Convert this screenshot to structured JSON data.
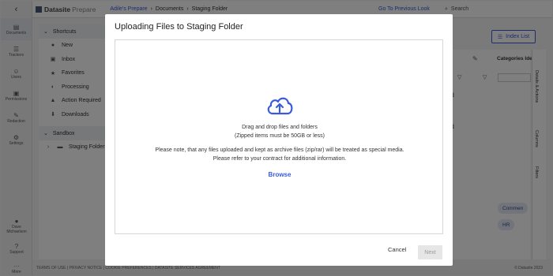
{
  "rail": {
    "items": [
      {
        "label": "Documents",
        "icon": "document-icon"
      },
      {
        "label": "Trackers",
        "icon": "list-icon"
      },
      {
        "label": "Users",
        "icon": "users-icon"
      },
      {
        "label": "Permissions",
        "icon": "lock-icon"
      },
      {
        "label": "Redaction",
        "icon": "pen-icon"
      },
      {
        "label": "Settings",
        "icon": "gear-icon"
      }
    ],
    "bottom": [
      {
        "label": "Dave\nMichaelson",
        "icon": "user-icon"
      },
      {
        "label": "Support",
        "icon": "help-icon"
      },
      {
        "label": "More",
        "icon": "more-icon"
      }
    ]
  },
  "topbar": {
    "brand": "Datasite",
    "product": "Prepare",
    "crumbs": [
      "Adile's Prepare",
      "Documents",
      "Staging Folder"
    ],
    "goto": "Go To Previous Look",
    "search": "Search"
  },
  "panel": {
    "shortcuts": "Shortcuts",
    "items": [
      "New",
      "Inbox",
      "Favorites",
      "Processing",
      "Action Required",
      "Downloads"
    ],
    "sandbox": "Sandbox",
    "folder": "Staging Folder"
  },
  "right": {
    "index_list": "Index List",
    "categories": "Categories Ide",
    "vtabs": [
      "Details & Actions",
      "Columns",
      "Filters"
    ],
    "pills": [
      "Commen",
      "HR"
    ],
    "fragments": [
      "ed",
      "ed"
    ]
  },
  "footer": {
    "links": "TERMS OF USE  |  PRIVACY NOTICE  |  COOKIE PREFERENCES  |  DATASITE SERVICES AGREEMENT",
    "copyright": "© Datasite 2023"
  },
  "modal": {
    "title": "Uploading Files to Staging Folder",
    "drag_text": "Drag and drop files and folders",
    "zip_note": "(Zipped items must be 50GB or less)",
    "archive_note": "Please note, that any files uploaded and kept as archive files (zip/rar) will be treated as special media.",
    "contract_note": "Please refer to your contract for additional information.",
    "browse": "Browse",
    "cancel": "Cancel",
    "next": "Next"
  }
}
